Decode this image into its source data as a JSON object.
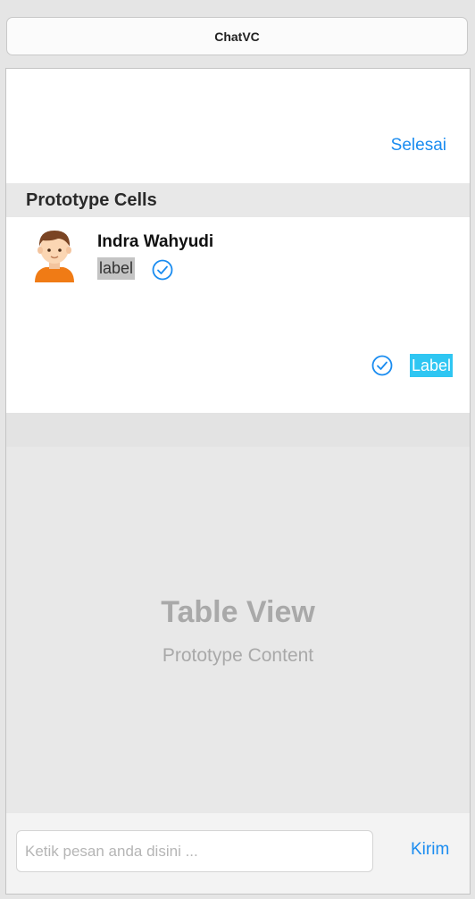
{
  "scene": {
    "title": "ChatVC"
  },
  "nav": {
    "done_label": "Selesai"
  },
  "section": {
    "header": "Prototype Cells"
  },
  "cell": {
    "name": "Indra Wahyudi",
    "sub_label": "label",
    "right_label": "Label",
    "icons": [
      "avatar-icon",
      "checkmark-circle-icon",
      "checkmark-circle-icon"
    ]
  },
  "table_view": {
    "title": "Table View",
    "subtitle": "Prototype Content"
  },
  "composer": {
    "placeholder": "Ketik pesan anda disini ...",
    "value": "",
    "send_label": "Kirim"
  },
  "colors": {
    "accent": "#1a8cf0",
    "highlight_label": "#2fc6f2",
    "avatar_shirt": "#f07b15"
  }
}
